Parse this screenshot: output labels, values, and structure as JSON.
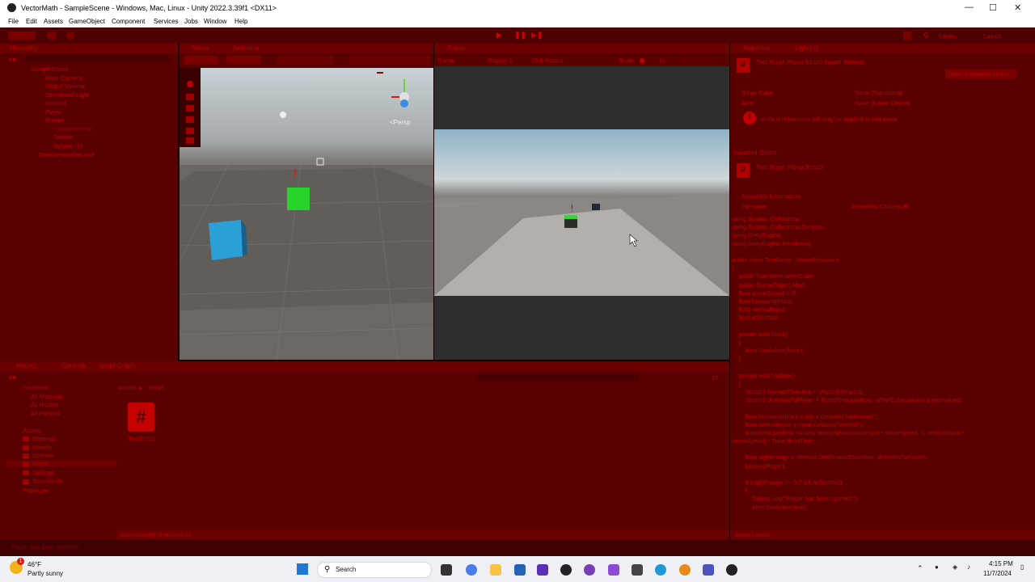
{
  "window": {
    "title": "VectorMath - SampleScene - Windows, Mac, Linux - Unity 2022.3.39f1 <DX11>"
  },
  "menu": [
    "File",
    "Edit",
    "Assets",
    "GameObject",
    "Component",
    "Services",
    "Jobs",
    "Window",
    "Help"
  ],
  "toolbar": {
    "layers": "Layers",
    "layout": "Layout"
  },
  "hierarchy": {
    "tab": "Hierarchy",
    "items": [
      "SampleScene",
      "Main Camera",
      "Global Volume",
      "Directional Light",
      "Ground",
      "Player",
      "Enemy",
      "SpotlightMesh",
      "Sphere",
      "Sphere (1)",
      "DontDestroyOnLoad"
    ]
  },
  "scene": {
    "tab_scene": "Scene",
    "tab_animator": "Animator",
    "persp": "<Persp"
  },
  "game": {
    "tab": "Game",
    "display": "Display 1",
    "aspect": "16:9 Aspect",
    "scale_label": "Scale",
    "scale_value": "1x",
    "play_focused": "Play Focused"
  },
  "inspector": {
    "tab_inspector": "Inspector",
    "tab_lighting": "Lighting",
    "title": "Test Script (Mono Script) Import Settings",
    "open": "Open",
    "exec_order": "Execution Order...",
    "fields": [
      {
        "label": "Other Cube",
        "value": "None (Transform)"
      },
      {
        "label": "Alert",
        "value": "None (Game Object)"
      }
    ],
    "warning": "Default references will only be applied in edit mode.",
    "imported_object": "Imported Object",
    "script_name": "Test Script (Mono Script)",
    "assembly_info": "Assembly Information",
    "filename_label": "Filename",
    "filename_value": "Assembly-CSharp.dll",
    "code_lines": [
      "using System.Collections;",
      "using System.Collections.Generic;",
      "using UnityEngine;",
      "using UnityEngine.Rendering;",
      "",
      "public class TestScript : MonoBehaviour",
      "{",
      "    public Transform otherCube;",
      "    public GameObject Alert;",
      "    float moveSpeed = 5f;",
      "    float horizontalInput;",
      "    float verticalInput;",
      "    bool isSpotted;",
      "",
      "    private void Start()",
      "    {",
      "        Alert.SetActive(false);",
      "    }",
      "",
      "    private void Update()",
      "    {",
      "        Vector3 forwardDirection = Vector3.forward;",
      "        Vector3 directionToPlayer = (transform.position - otherCube.position).normalized;",
      "",
      "        float horizontalInput = Input.GetAxis(\"Horizontal\");",
      "        float verticalInput = Input.GetAxis(\"Vertical\");",
      "        transform.position += new Vector3(horizontalInput * moveSpeed, 0, verticalInput *",
      "moveSpeed) * Time.deltaTime;",
      "",
      "        float sightRange = Vector3.Dot(forwardDirection, directionToPlayer);",
      "        Look(isPlayer);",
      "",
      "        if (sightRange >= 0.7 && !isSpotted)",
      "        {",
      "            Debug.Log(\"Player has been spotted!\");",
      "            Alert.SetActive(true);"
    ],
    "asset_labels": "Asset Labels"
  },
  "project": {
    "tab_project": "Project",
    "tab_console": "Console",
    "tab_graph": "Script Graph",
    "breadcrumb": [
      "Assets",
      "Script"
    ],
    "favorites": "Favorites",
    "fav_items": [
      "All Materials",
      "All Models",
      "All Prefabs"
    ],
    "assets": "Assets",
    "folders": [
      "Materials",
      "Models",
      "Scenes",
      "Script",
      "Settings",
      "TutorialInfo"
    ],
    "packages": "Packages",
    "file_name": "TestScript",
    "path": "Assets/Script/TestScript.cs",
    "count": "17"
  },
  "status": {
    "message": "Player has been spotted!"
  },
  "taskbar": {
    "temp": "46°F",
    "weather": "Partly sunny",
    "search": "Search",
    "time": "4:15 PM",
    "date": "11/7/2024",
    "badge": "1"
  }
}
